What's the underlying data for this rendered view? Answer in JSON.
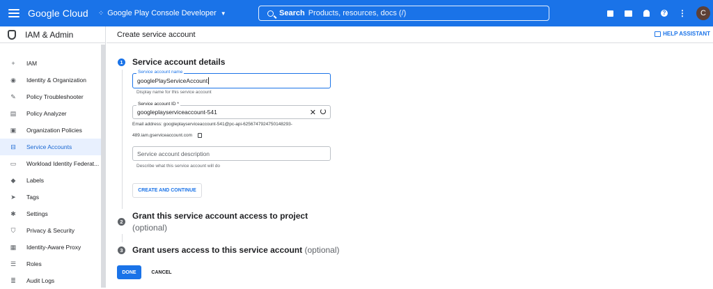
{
  "topbar": {
    "brand": "Google Cloud",
    "project": "Google Play Console Developer",
    "search_label": "Search",
    "search_placeholder": "Products, resources, docs (/)",
    "avatar_letter": "C",
    "color": "#1a73e8"
  },
  "sidebar": {
    "title": "IAM & Admin",
    "items": [
      {
        "label": "IAM",
        "icon": "person-add-icon"
      },
      {
        "label": "Identity & Organization",
        "icon": "account-circle-icon"
      },
      {
        "label": "Policy Troubleshooter",
        "icon": "wrench-icon"
      },
      {
        "label": "Policy Analyzer",
        "icon": "document-search-icon"
      },
      {
        "label": "Organization Policies",
        "icon": "list-alt-icon"
      },
      {
        "label": "Service Accounts",
        "icon": "service-account-icon",
        "active": true
      },
      {
        "label": "Workload Identity Federat...",
        "icon": "id-card-icon"
      },
      {
        "label": "Labels",
        "icon": "label-icon"
      },
      {
        "label": "Tags",
        "icon": "tag-icon"
      },
      {
        "label": "Settings",
        "icon": "gear-icon"
      },
      {
        "label": "Privacy & Security",
        "icon": "shield-icon"
      },
      {
        "label": "Identity-Aware Proxy",
        "icon": "proxy-icon"
      },
      {
        "label": "Roles",
        "icon": "roles-icon"
      },
      {
        "label": "Audit Logs",
        "icon": "list-icon"
      }
    ]
  },
  "main": {
    "page_title": "Create service account",
    "help_assistant": "HELP ASSISTANT",
    "steps": [
      {
        "number": "1",
        "title": "Service account details"
      },
      {
        "number": "2",
        "title": "Grant this service account access to project",
        "optional": "(optional)"
      },
      {
        "number": "3",
        "title": "Grant users access to this service account",
        "optional": "(optional)"
      }
    ],
    "fields": {
      "name": {
        "label": "Service account name",
        "value": "googlePlayServiceAccount",
        "hint": "Display name for this service account"
      },
      "id": {
        "label": "Service account ID *",
        "value": "googleplayserviceaccount-541"
      },
      "email_line1": "Email address: googleplayserviceaccount-541@pc-api-6256747924750148293-",
      "email_line2": "489.iam.gserviceaccount.com",
      "description": {
        "placeholder": "Service account description",
        "hint": "Describe what this service account will do"
      }
    },
    "create_continue": "CREATE AND CONTINUE",
    "done": "DONE",
    "cancel": "CANCEL"
  }
}
